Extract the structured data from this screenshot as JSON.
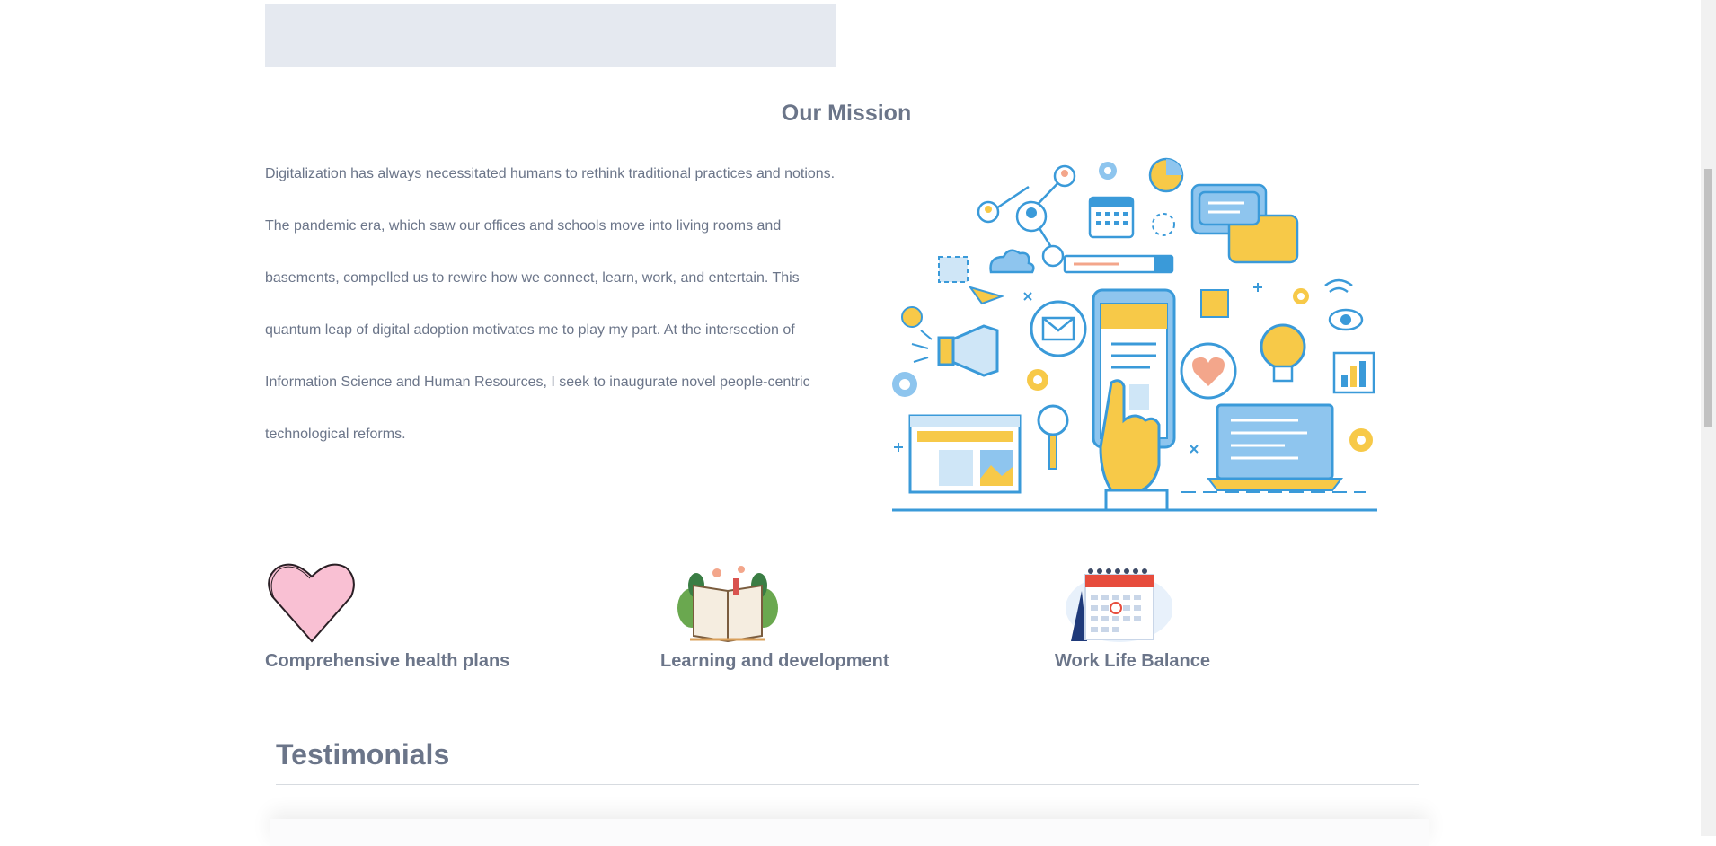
{
  "mission": {
    "title": "Our Mission",
    "paragraph": "Digitalization has always necessitated humans to rethink traditional practices and notions. The pandemic era, which saw our offices and schools move into living rooms and basements, compelled us to rewire how we connect, learn, work, and entertain. This quantum leap of digital adoption motivates me to play my part. At the intersection of Information Science and Human Resources, I seek to inaugurate novel people-centric technological reforms.",
    "illustration_icon": "digital-devices-illustration"
  },
  "features": [
    {
      "label": "Comprehensive health plans",
      "icon": "heart-icon"
    },
    {
      "label": "Learning and development",
      "icon": "open-book-icon"
    },
    {
      "label": "Work Life Balance",
      "icon": "calendar-icon"
    }
  ],
  "testimonials": {
    "title": "Testimonials"
  },
  "colors": {
    "text": "#6b7589",
    "accent_blue": "#3a9ad9",
    "accent_yellow": "#f7c948",
    "heart_pink": "#f9c0d3"
  }
}
